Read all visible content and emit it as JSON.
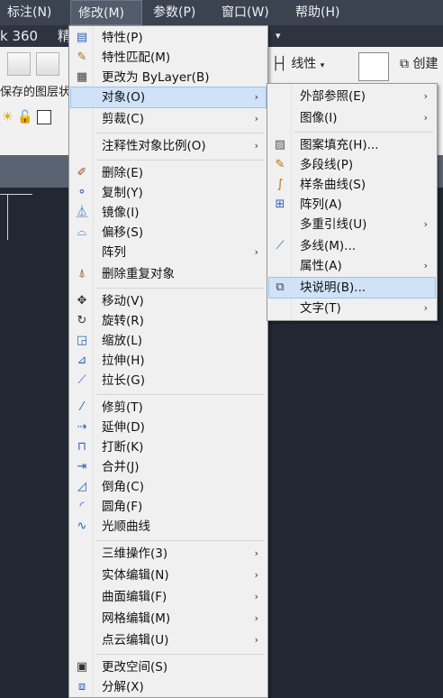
{
  "menubar": {
    "items": [
      {
        "label": "标注(N)"
      },
      {
        "label": "修改(M)"
      },
      {
        "label": "参数(P)"
      },
      {
        "label": "窗口(W)"
      },
      {
        "label": "帮助(H)"
      }
    ]
  },
  "titlebar": {
    "left": "k 360",
    "partial": "精",
    "dropdown_glyph": "▾"
  },
  "ribbon": {
    "layer_text": "保存的图层状",
    "linetype_label": "线性",
    "create_label": "创建"
  },
  "modify_menu": {
    "items": [
      {
        "label": "特性(P)",
        "icon": "properties-icon"
      },
      {
        "label": "特性匹配(M)",
        "icon": "match-properties-icon"
      },
      {
        "label": "更改为 ByLayer(B)",
        "icon": "bylayer-icon"
      },
      {
        "label": "对象(O)",
        "has_submenu": true,
        "highlighted": true
      },
      {
        "label": "剪裁(C)",
        "has_submenu": true
      },
      {
        "label": "注释性对象比例(O)",
        "has_submenu": true
      },
      {
        "label": "删除(E)",
        "icon": "erase-icon"
      },
      {
        "label": "复制(Y)",
        "icon": "copy-icon"
      },
      {
        "label": "镜像(I)",
        "icon": "mirror-icon"
      },
      {
        "label": "偏移(S)",
        "icon": "offset-icon"
      },
      {
        "label": "阵列",
        "has_submenu": true
      },
      {
        "label": "删除重复对象",
        "icon": "overkill-icon"
      },
      {
        "label": "移动(V)",
        "icon": "move-icon"
      },
      {
        "label": "旋转(R)",
        "icon": "rotate-icon"
      },
      {
        "label": "缩放(L)",
        "icon": "scale-icon"
      },
      {
        "label": "拉伸(H)",
        "icon": "stretch-icon"
      },
      {
        "label": "拉长(G)",
        "icon": "lengthen-icon"
      },
      {
        "label": "修剪(T)",
        "icon": "trim-icon"
      },
      {
        "label": "延伸(D)",
        "icon": "extend-icon"
      },
      {
        "label": "打断(K)",
        "icon": "break-icon"
      },
      {
        "label": "合并(J)",
        "icon": "join-icon"
      },
      {
        "label": "倒角(C)",
        "icon": "chamfer-icon"
      },
      {
        "label": "圆角(F)",
        "icon": "fillet-icon"
      },
      {
        "label": "光顺曲线",
        "icon": "blend-curve-icon"
      },
      {
        "label": "三维操作(3)",
        "has_submenu": true
      },
      {
        "label": "实体编辑(N)",
        "has_submenu": true
      },
      {
        "label": "曲面编辑(F)",
        "has_submenu": true
      },
      {
        "label": "网格编辑(M)",
        "has_submenu": true
      },
      {
        "label": "点云编辑(U)",
        "has_submenu": true
      },
      {
        "label": "更改空间(S)",
        "icon": "change-space-icon"
      },
      {
        "label": "分解(X)",
        "icon": "explode-icon"
      }
    ]
  },
  "object_submenu": {
    "items": [
      {
        "label": "外部参照(E)",
        "has_submenu": true
      },
      {
        "label": "图像(I)",
        "has_submenu": true
      },
      {
        "label": "图案填充(H)...",
        "icon": "hatch-edit-icon"
      },
      {
        "label": "多段线(P)",
        "icon": "polyline-edit-icon"
      },
      {
        "label": "样条曲线(S)",
        "icon": "spline-edit-icon"
      },
      {
        "label": "阵列(A)",
        "icon": "array-edit-icon"
      },
      {
        "label": "多重引线(U)",
        "has_submenu": true
      },
      {
        "label": "多线(M)...",
        "icon": "multiline-edit-icon"
      },
      {
        "label": "属性(A)",
        "has_submenu": true
      },
      {
        "label": "块说明(B)...",
        "icon": "block-description-icon",
        "highlighted": true
      },
      {
        "label": "文字(T)",
        "has_submenu": true
      }
    ]
  },
  "colors": {
    "menu_bg": "#f0f0f0",
    "highlight": "#cfe2f7",
    "menubar_bg": "#3b4250",
    "canvas_bg": "#212833"
  }
}
